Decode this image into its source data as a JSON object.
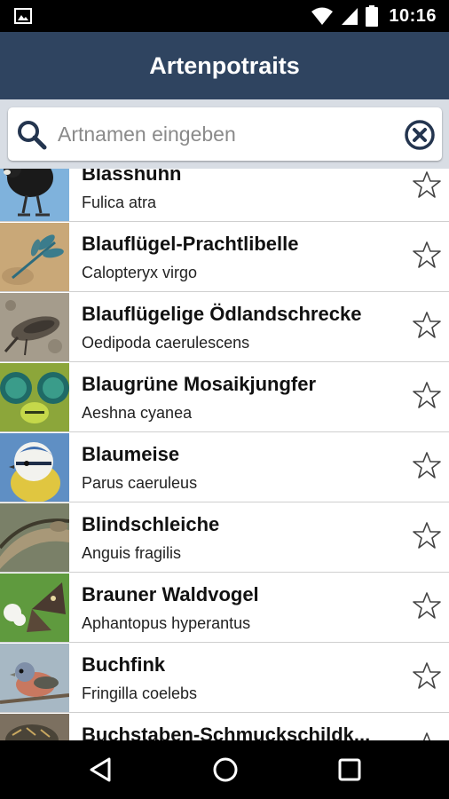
{
  "status_bar": {
    "time": "10:16",
    "left_icon": "gallery-icon",
    "right_icons": [
      "wifi-icon",
      "cellular-signal-icon",
      "battery-icon"
    ]
  },
  "app_bar": {
    "title": "Artenpotraits",
    "background_color": "#2f4460"
  },
  "search": {
    "placeholder": "Artnamen eingeben",
    "value": "",
    "left_icon": "search-icon",
    "right_icon": "clear-icon"
  },
  "species_list": {
    "items": [
      {
        "name": "Blässhuhn",
        "latin": "Fulica atra",
        "favorite": false
      },
      {
        "name": "Blauflügel-Prachtlibelle",
        "latin": "Calopteryx virgo",
        "favorite": false
      },
      {
        "name": "Blauflügelige Ödlandschrecke",
        "latin": "Oedipoda caerulescens",
        "favorite": false
      },
      {
        "name": "Blaugrüne Mosaikjungfer",
        "latin": "Aeshna cyanea",
        "favorite": false
      },
      {
        "name": "Blaumeise",
        "latin": "Parus caeruleus",
        "favorite": false
      },
      {
        "name": "Blindschleiche",
        "latin": "Anguis fragilis",
        "favorite": false
      },
      {
        "name": "Brauner Waldvogel",
        "latin": "Aphantopus hyperantus",
        "favorite": false
      },
      {
        "name": "Buchfink",
        "latin": "Fringilla coelebs",
        "favorite": false
      },
      {
        "name": "Buchstaben-Schmuckschildk...",
        "latin": "",
        "favorite": false
      }
    ]
  },
  "nav_bar": {
    "buttons": [
      "back-icon",
      "home-icon",
      "recents-icon"
    ]
  }
}
